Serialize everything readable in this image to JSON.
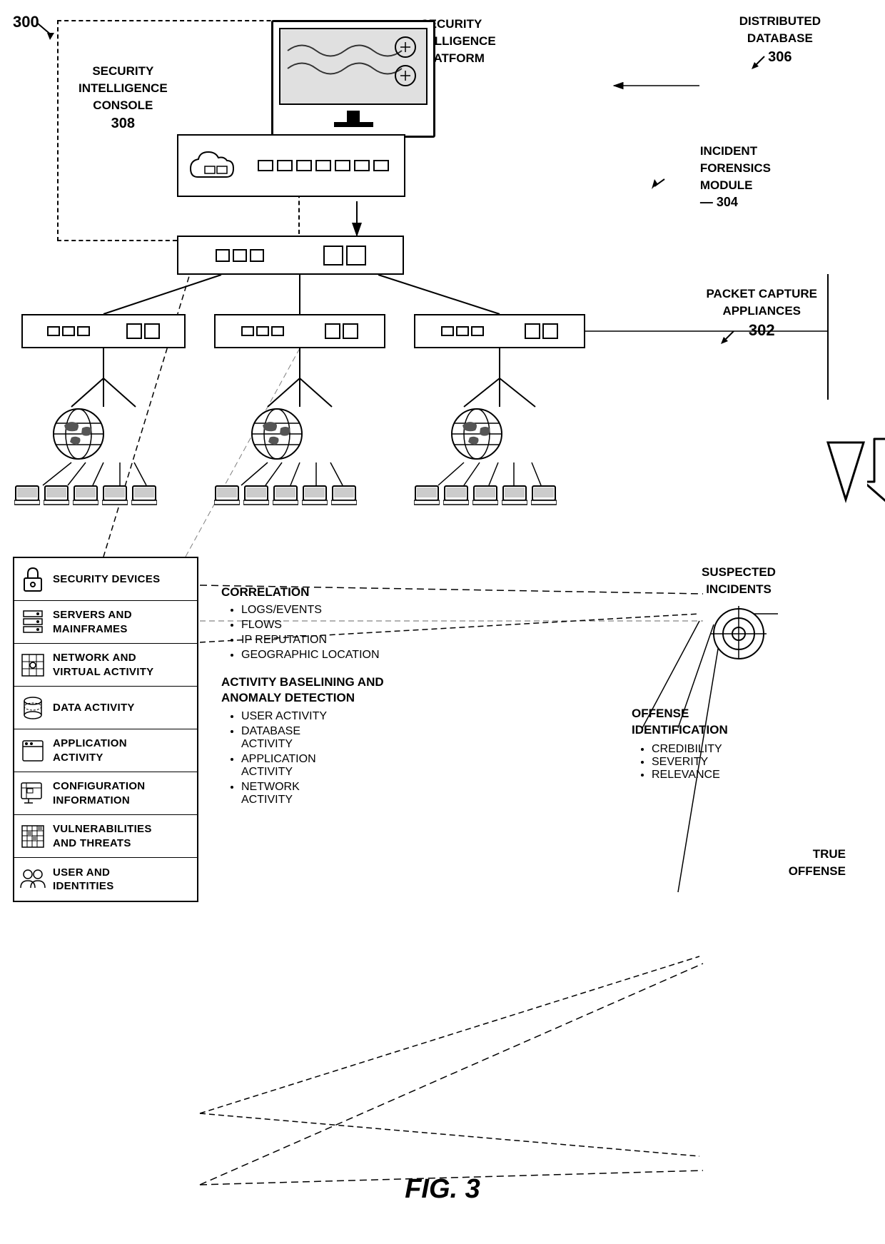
{
  "diagram": {
    "figure_number": "FIG. 3",
    "ref_300": "300",
    "labels": {
      "distributed_database": "DISTRIBUTED\nDATABASE",
      "distributed_database_ref": "306",
      "security_intelligence_platform": "SECURITY\nINTELLIGENCE\nPLATFORM",
      "security_intelligence_console": "SECURITY\nINTELLIGENCE\nCONSOLE",
      "security_intelligence_console_ref": "308",
      "incident_forensics_module": "INCIDENT\nFORENSICS\nMODULE",
      "incident_forensics_module_ref": "304",
      "packet_capture_appliances": "PACKET CAPTURE\nAPPLIANCES",
      "packet_capture_appliances_ref": "302"
    },
    "correlation": {
      "title": "CORRELATION",
      "items": [
        "LOGS/EVENTS",
        "FLOWS",
        "IP REPUTATION",
        "GEOGRAPHIC LOCATION"
      ]
    },
    "activity_baselining": {
      "title": "ACTIVITY BASELINING AND\nANOMALY DETECTION",
      "items": [
        "USER ACTIVITY",
        "DATABASE\nACTIVITY",
        "APPLICATION\nACTIVITY",
        "NETWORK\nACTIVITY"
      ]
    },
    "suspected_incidents": {
      "title": "SUSPECTED\nINCIDENTS"
    },
    "offense_identification": {
      "title": "OFFENSE\nIDENTIFICATION",
      "items": [
        "CREDIBILITY",
        "SEVERITY",
        "RELEVANCE"
      ]
    },
    "true_offense": {
      "title": "TRUE\nOFFENSE"
    },
    "legend": {
      "items": [
        {
          "id": "security-devices",
          "label": "SECURITY\nDEVICES",
          "icon": "lock"
        },
        {
          "id": "servers-mainframes",
          "label": "SERVERS AND\nMAINFRAMES",
          "icon": "server"
        },
        {
          "id": "network-virtual-activity",
          "label": "NETWORK AND\nVIRTUAL ACTIVITY",
          "icon": "grid"
        },
        {
          "id": "data-activity",
          "label": "DATA ACTIVITY",
          "icon": "cylinder"
        },
        {
          "id": "application-activity",
          "label": "APPLICATION\nACTIVITY",
          "icon": "window"
        },
        {
          "id": "configuration-information",
          "label": "CONFIGURATION\nINFORMATION",
          "icon": "monitor-small"
        },
        {
          "id": "vulnerabilities-threats",
          "label": "VULNERABILITIES\nAND THREATS",
          "icon": "grid-hash"
        },
        {
          "id": "user-identities",
          "label": "USER AND\nIDENTITIES",
          "icon": "users"
        }
      ]
    }
  }
}
